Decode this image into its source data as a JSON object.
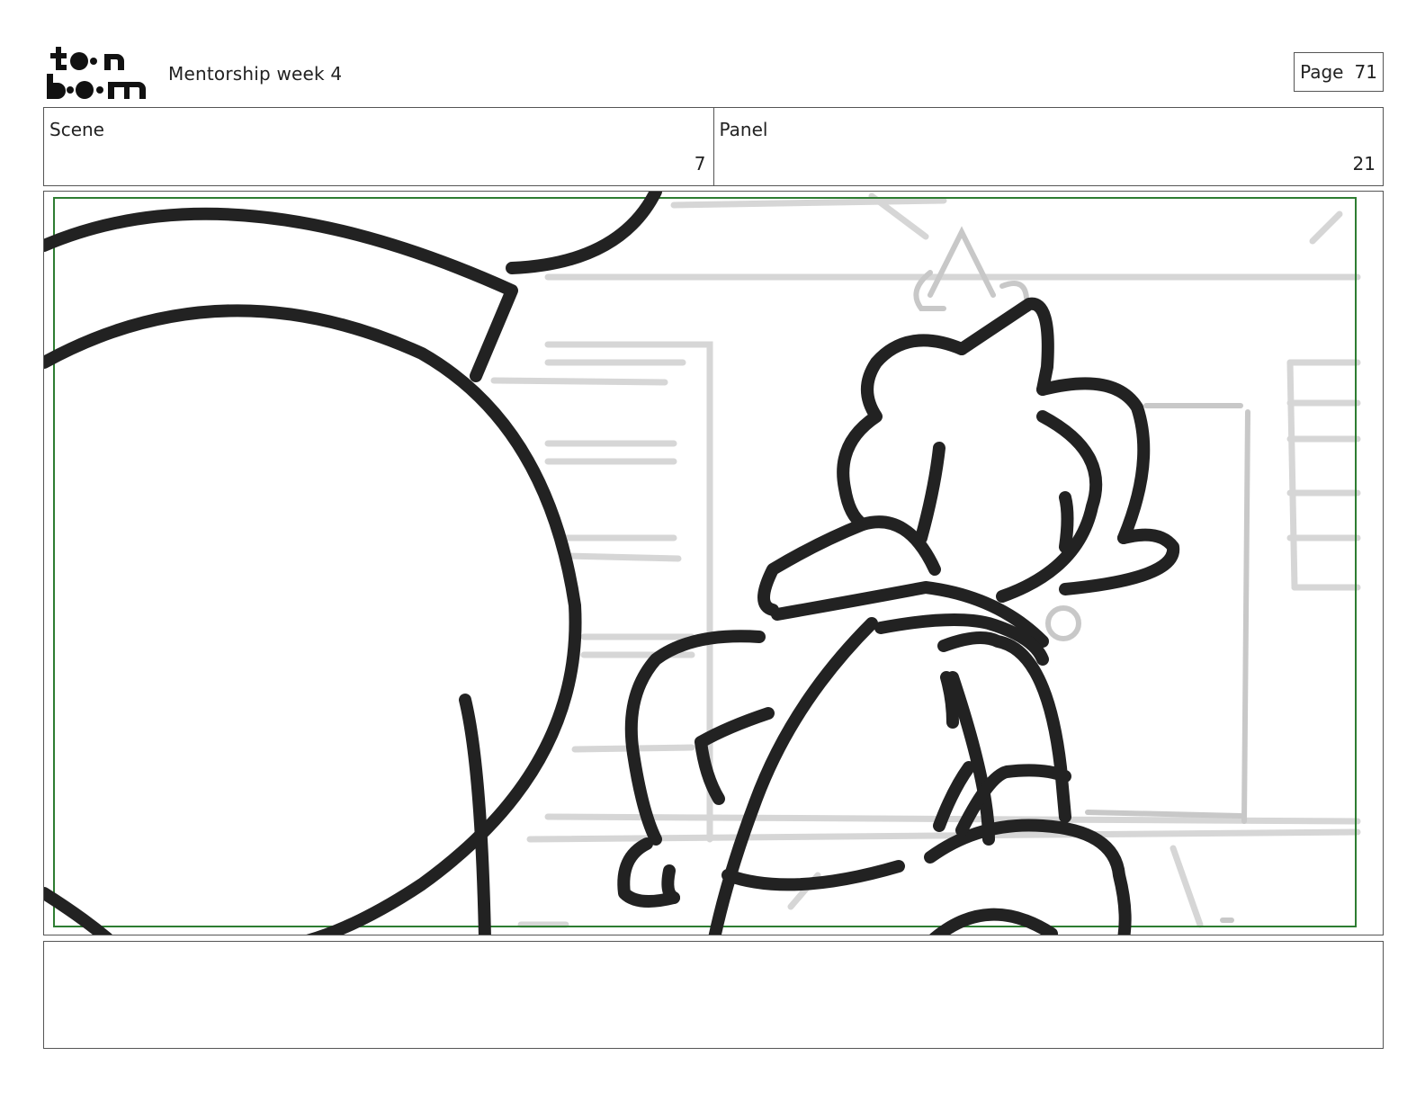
{
  "header": {
    "logo_text": "toon boom",
    "document_title": "Mentorship week 4",
    "page_label": "Page",
    "page_number": "71"
  },
  "info": {
    "scene_label": "Scene",
    "scene_value": "7",
    "panel_label": "Panel",
    "panel_value": "21"
  },
  "panel": {
    "image_name": "storyboard-sketch",
    "safe_area_color": "#2e7d32"
  },
  "notes": {
    "text": ""
  }
}
